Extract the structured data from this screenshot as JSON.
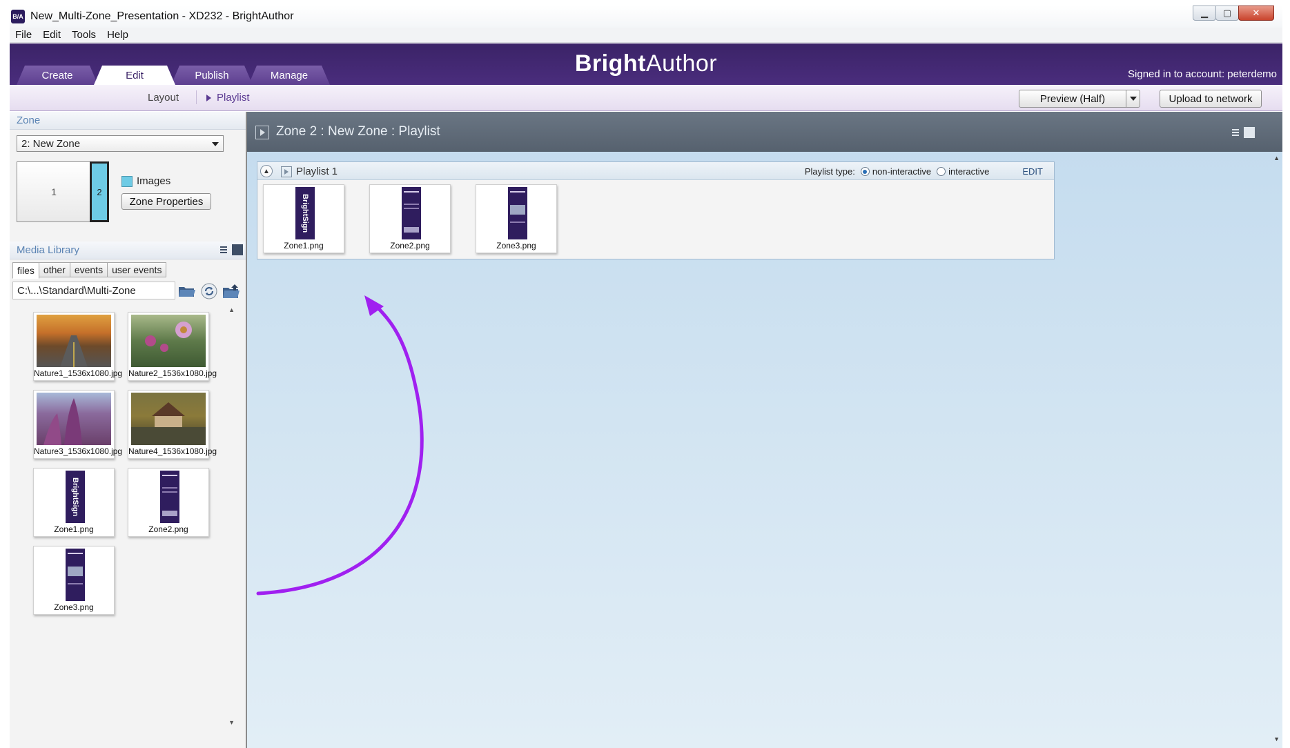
{
  "window": {
    "title": "New_Multi-Zone_Presentation - XD232 - BrightAuthor",
    "app_icon": "B/A"
  },
  "menu": [
    "File",
    "Edit",
    "Tools",
    "Help"
  ],
  "header": {
    "tabs": [
      {
        "label": "Create"
      },
      {
        "label": "Edit"
      },
      {
        "label": "Publish"
      },
      {
        "label": "Manage"
      }
    ],
    "logo_bold": "Bright",
    "logo_light": "Author",
    "signed_in": "Signed in to account: peterdemo"
  },
  "subbar": {
    "layout": "Layout",
    "playlist": "Playlist",
    "preview": "Preview (Half)",
    "upload": "Upload to network"
  },
  "zone": {
    "header": "Zone",
    "selected": "2: New Zone",
    "zone1": "1",
    "zone2": "2",
    "images_label": "Images",
    "properties_button": "Zone Properties"
  },
  "media_library": {
    "header": "Media Library",
    "tabs": [
      "files",
      "other",
      "events",
      "user events"
    ],
    "path": "C:\\...\\Standard\\Multi-Zone",
    "files": [
      {
        "name": "Nature1_1536x1080.jpg"
      },
      {
        "name": "Nature2_1536x1080.jpg"
      },
      {
        "name": "Nature3_1536x1080.jpg"
      },
      {
        "name": "Nature4_1536x1080.jpg"
      },
      {
        "name": "Zone1.png"
      },
      {
        "name": "Zone2.png"
      },
      {
        "name": "Zone3.png"
      }
    ]
  },
  "content": {
    "title": "Zone 2 : New Zone :  Playlist",
    "playlist": {
      "name": "Playlist 1",
      "type_label": "Playlist type:",
      "option_non_interactive": "non-interactive",
      "option_interactive": "interactive",
      "edit": "EDIT",
      "items": [
        {
          "name": "Zone1.png"
        },
        {
          "name": "Zone2.png"
        },
        {
          "name": "Zone3.png"
        }
      ]
    }
  },
  "banner_text": "BrightSign",
  "colors": {
    "brand_purple": "#3b2367",
    "zone_highlight": "#6ecbe5",
    "arrow": "#a020f0"
  }
}
